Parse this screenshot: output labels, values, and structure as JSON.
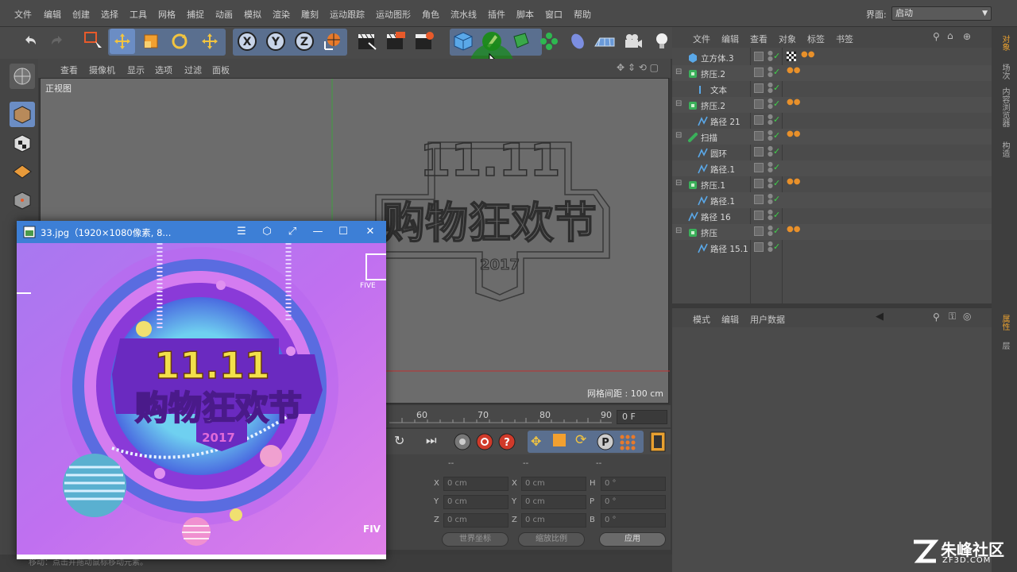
{
  "menubar": {
    "items": [
      "文件",
      "编辑",
      "创建",
      "选择",
      "工具",
      "网格",
      "捕捉",
      "动画",
      "模拟",
      "渲染",
      "雕刻",
      "运动跟踪",
      "运动图形",
      "角色",
      "流水线",
      "插件",
      "脚本",
      "窗口",
      "帮助"
    ],
    "layout_label": "界面:",
    "layout_value": "启动"
  },
  "viewport": {
    "menu": [
      "查看",
      "摄像机",
      "显示",
      "选项",
      "过滤",
      "面板"
    ],
    "view_name": "正视图",
    "grid_info": "网格间距 : 100 cm",
    "artwork": {
      "line1": "11.11",
      "line2": "购物狂欢节",
      "year": "2017"
    }
  },
  "timeline": {
    "ticks": [
      "60",
      "70",
      "80",
      "90"
    ],
    "frame": "0 F"
  },
  "coordinates": {
    "headers": [
      "--",
      "--",
      "--"
    ],
    "rows": [
      {
        "l1": "X",
        "v1": "0 cm",
        "l2": "X",
        "v2": "0 cm",
        "l3": "H",
        "v3": "0 °"
      },
      {
        "l1": "Y",
        "v1": "0 cm",
        "l2": "Y",
        "v2": "0 cm",
        "l3": "P",
        "v3": "0 °"
      },
      {
        "l1": "Z",
        "v1": "0 cm",
        "l2": "Z",
        "v2": "0 cm",
        "l3": "B",
        "v3": "0 °"
      }
    ],
    "coord_mode": "世界坐标",
    "scale_mode": "缩放比例",
    "apply": "应用"
  },
  "status": "移动：点击并拖动鼠标移动元素。",
  "object_manager": {
    "menu": [
      "文件",
      "编辑",
      "查看",
      "对象",
      "标签",
      "书签"
    ],
    "objects": [
      {
        "name": "立方体.3",
        "indent": 0,
        "icon": "cube-icon"
      },
      {
        "name": "挤压.2",
        "indent": 0,
        "icon": "extrude-icon"
      },
      {
        "name": "文本",
        "indent": 1,
        "icon": "text-spline-icon"
      },
      {
        "name": "挤压.2",
        "indent": 0,
        "icon": "extrude-icon"
      },
      {
        "name": "路径 21",
        "indent": 1,
        "icon": "spline-icon"
      },
      {
        "name": "扫描",
        "indent": 0,
        "icon": "sweep-icon"
      },
      {
        "name": "圆环",
        "indent": 1,
        "icon": "spline-icon"
      },
      {
        "name": "路径.1",
        "indent": 1,
        "icon": "spline-icon"
      },
      {
        "name": "挤压.1",
        "indent": 0,
        "icon": "extrude-icon"
      },
      {
        "name": "路径.1",
        "indent": 1,
        "icon": "spline-icon"
      },
      {
        "name": "路径 16",
        "indent": 0,
        "icon": "spline-icon"
      },
      {
        "name": "挤压",
        "indent": 0,
        "icon": "extrude-icon"
      },
      {
        "name": "路径 15.1",
        "indent": 1,
        "icon": "spline-icon"
      }
    ]
  },
  "attribute_manager": {
    "menu": [
      "模式",
      "编辑",
      "用户数据"
    ]
  },
  "right_tabs": [
    "对象",
    "场次",
    "内容浏览器",
    "构造",
    "属性",
    "层"
  ],
  "image_viewer": {
    "title": "33.jpg（1920×1080像素, 8...",
    "poster": {
      "line1": "11.11",
      "line2": "购物狂欢节",
      "year": "2017",
      "side_text": "FIVE",
      "side_text2": "FIV"
    }
  },
  "watermark": {
    "main": "朱峰社区",
    "sub": "ZF3D.COM"
  },
  "colors": {
    "accent_blue": "#3d7fd6",
    "poster_bg": "#c86ef0",
    "poster_yellow": "#f2e04a",
    "poster_purple": "#8a3ad8"
  }
}
